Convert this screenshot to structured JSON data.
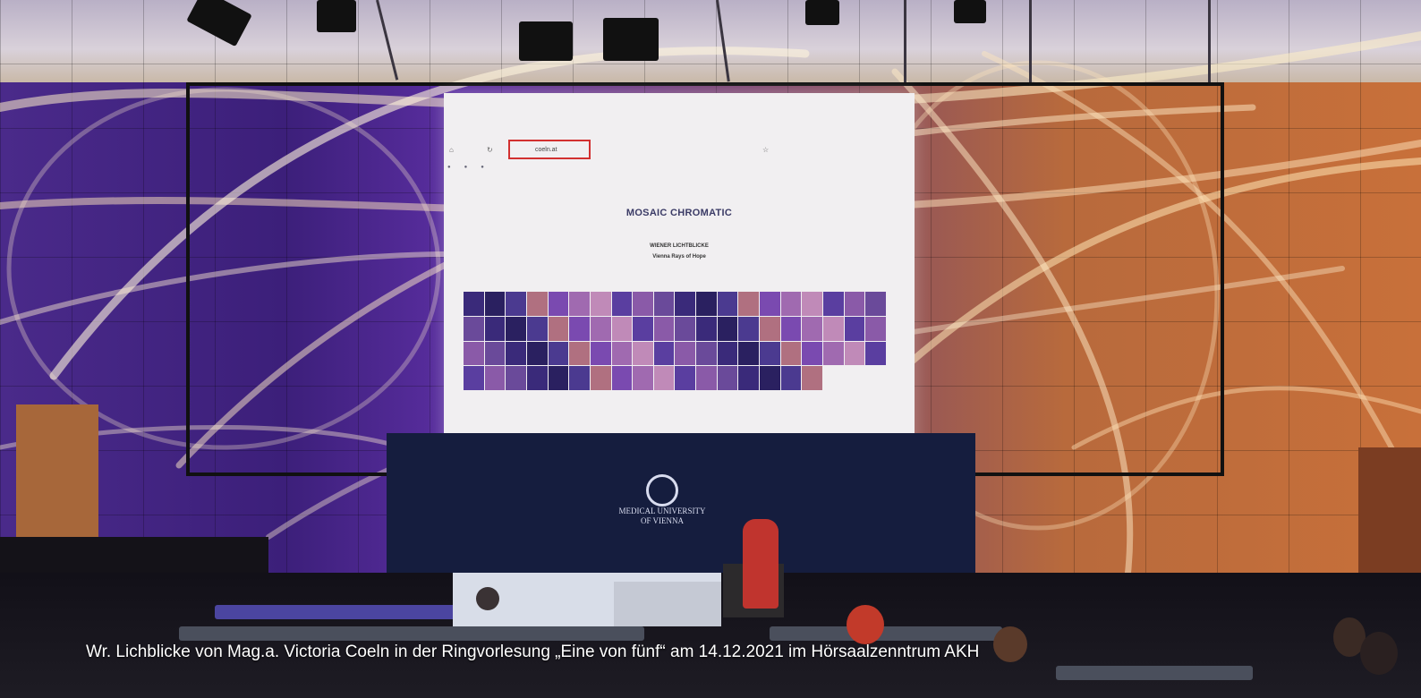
{
  "caption": "Wr. Lichblicke von Mag.a. Victoria Coeln in der Ringvorlesung „Eine von fünf“ am 14.12.2021 im Hörsaalzenntrum AKH",
  "slide": {
    "url": "coeln.at",
    "title": "MOSAIC CHROMATIC",
    "line1": "WIENER LICHTBLICKE",
    "line2": "Vienna Rays of Hope"
  },
  "podium": {
    "logo_text_1": "MEDICAL UNIVERSITY",
    "logo_text_2": "OF VIENNA"
  },
  "colors": {
    "wall_purple": "#4a2a8a",
    "wall_orange": "#c8703a",
    "speaker_red": "#c0342e",
    "url_highlight": "#d23030"
  },
  "icons": [
    "ceiling-speaker-icon",
    "medical-university-logo-icon"
  ]
}
